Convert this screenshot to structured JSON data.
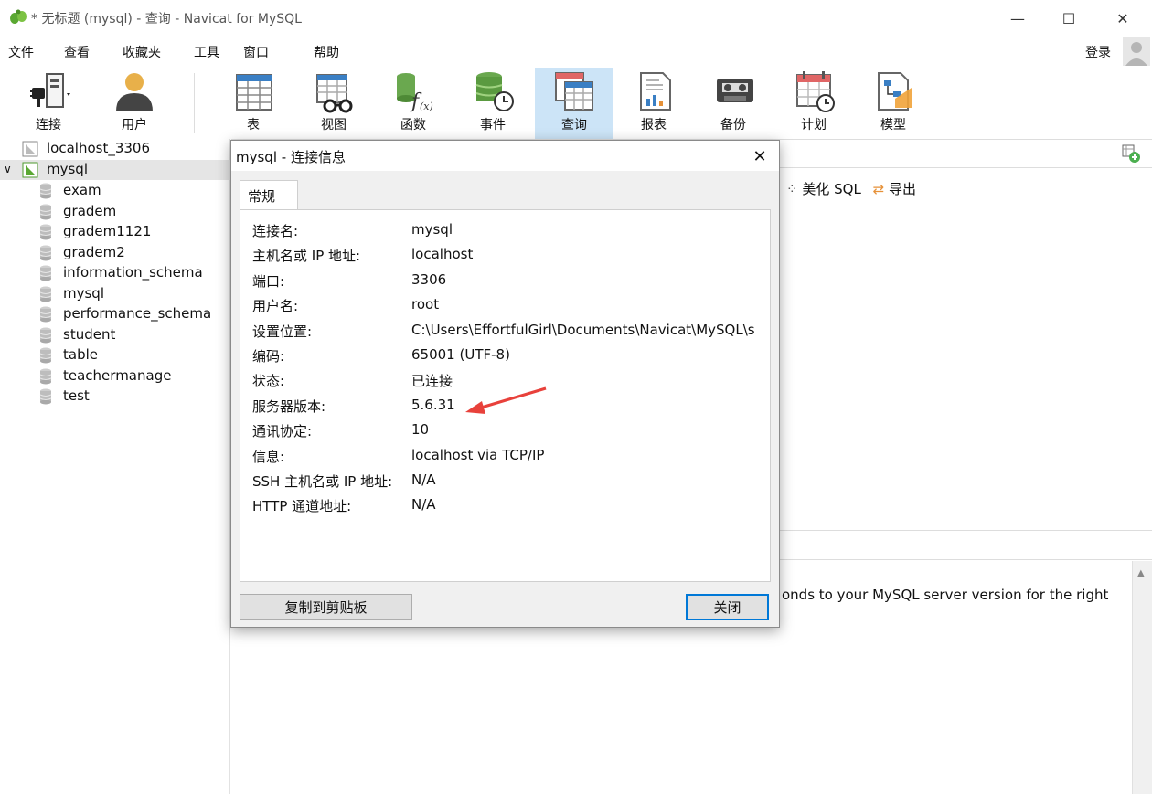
{
  "window": {
    "title": "* 无标题 (mysql) - 查询 - Navicat for MySQL",
    "min_glyph": "—",
    "max_glyph": "☐",
    "close_glyph": "✕"
  },
  "menu": [
    "文件",
    "查看",
    "收藏夹",
    "工具",
    "窗口",
    "帮助"
  ],
  "login_label": "登录",
  "toolbar": [
    {
      "label": "连接",
      "icon": "connection-plug-icon"
    },
    {
      "label": "用户",
      "icon": "user-icon"
    },
    {
      "label": "表",
      "icon": "table-icon"
    },
    {
      "label": "视图",
      "icon": "view-glasses-icon"
    },
    {
      "label": "函数",
      "icon": "function-icon"
    },
    {
      "label": "事件",
      "icon": "event-clock-icon"
    },
    {
      "label": "查询",
      "icon": "query-icon",
      "active": true
    },
    {
      "label": "报表",
      "icon": "report-icon"
    },
    {
      "label": "备份",
      "icon": "backup-tape-icon"
    },
    {
      "label": "计划",
      "icon": "schedule-calendar-icon"
    },
    {
      "label": "模型",
      "icon": "model-icon"
    }
  ],
  "sidebar": {
    "connections": [
      {
        "name": "localhost_3306",
        "expanded": false
      },
      {
        "name": "mysql",
        "expanded": true,
        "selected": true
      }
    ],
    "databases": [
      "exam",
      "gradem",
      "gradem1121",
      "gradem2",
      "information_schema",
      "mysql",
      "performance_schema",
      "student",
      "table",
      "teachermanage",
      "test"
    ]
  },
  "editor": {
    "beautify_label": "美化 SQL",
    "export_label": "导出"
  },
  "results": {
    "message_fragment": "onds to your MySQL server version for the right"
  },
  "dialog": {
    "title": "mysql - 连接信息",
    "tab_label": "常规",
    "rows": [
      {
        "label": "连接名:",
        "value": "mysql"
      },
      {
        "label": "主机名或 IP 地址:",
        "value": "localhost"
      },
      {
        "label": "端口:",
        "value": "3306"
      },
      {
        "label": "用户名:",
        "value": "root"
      },
      {
        "label": "设置位置:",
        "value": "C:\\Users\\EffortfulGirl\\Documents\\Navicat\\MySQL\\s"
      },
      {
        "label": "编码:",
        "value": "65001 (UTF-8)"
      },
      {
        "label": "状态:",
        "value": "已连接"
      },
      {
        "label": "服务器版本:",
        "value": "5.6.31"
      },
      {
        "label": "通讯协定:",
        "value": "10"
      },
      {
        "label": "信息:",
        "value": "localhost via TCP/IP"
      },
      {
        "label": "SSH 主机名或 IP 地址:",
        "value": "N/A"
      },
      {
        "label": "HTTP 通道地址:",
        "value": "N/A"
      }
    ],
    "copy_button": "复制到剪贴板",
    "close_button": "关闭",
    "annotation_color": "#e8413b"
  },
  "colors": {
    "active_tool_bg": "#cce4f7",
    "navicat_green": "#5aa832",
    "button_focus": "#0078d7"
  }
}
